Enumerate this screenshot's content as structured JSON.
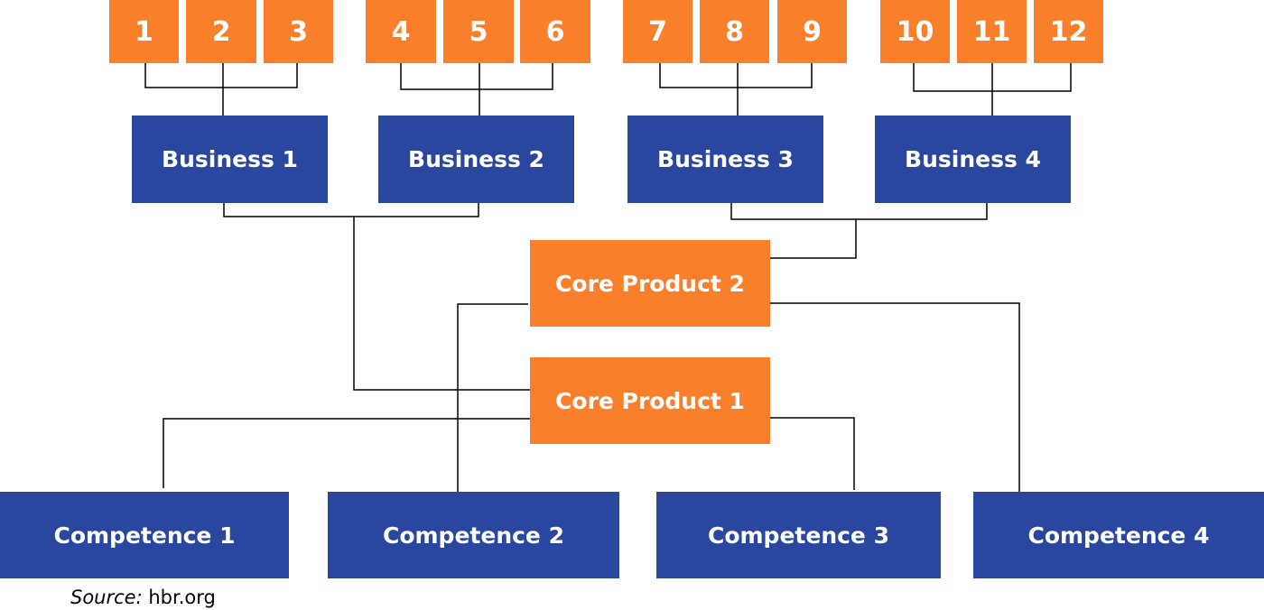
{
  "colors": {
    "orange": "#FA7F2A",
    "blue": "#29479F",
    "line": "#000000"
  },
  "items": [
    "1",
    "2",
    "3",
    "4",
    "5",
    "6",
    "7",
    "8",
    "9",
    "10",
    "11",
    "12"
  ],
  "businesses": [
    "Business 1",
    "Business 2",
    "Business 3",
    "Business 4"
  ],
  "core_products": {
    "cp1": "Core Product 1",
    "cp2": "Core Product 2"
  },
  "competences": [
    "Competence 1",
    "Competence 2",
    "Competence 3",
    "Competence 4"
  ],
  "source": {
    "label": "Source:",
    "value": "hbr.org"
  }
}
